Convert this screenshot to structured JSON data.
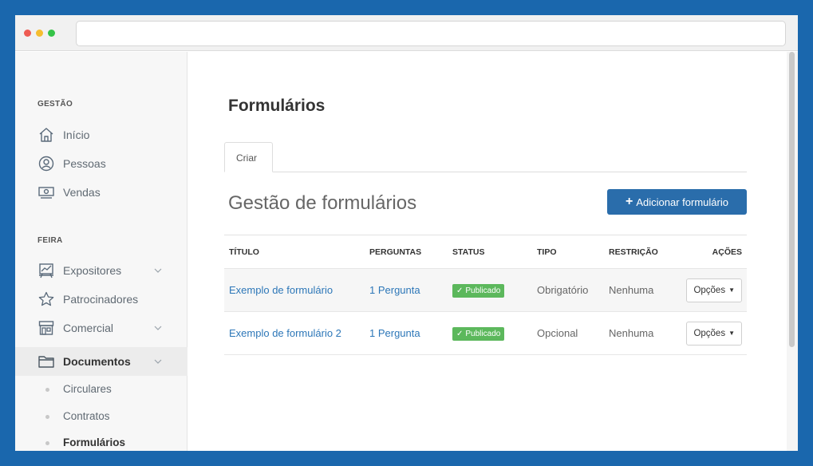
{
  "sidebar": {
    "sections": [
      {
        "label": "GESTÃO",
        "items": [
          {
            "label": "Início",
            "icon": "home-icon"
          },
          {
            "label": "Pessoas",
            "icon": "person-icon"
          },
          {
            "label": "Vendas",
            "icon": "money-icon"
          }
        ]
      },
      {
        "label": "FEIRA",
        "items": [
          {
            "label": "Expositores",
            "icon": "chart-board-icon",
            "expandable": true
          },
          {
            "label": "Patrocinadores",
            "icon": "star-icon"
          },
          {
            "label": "Comercial",
            "icon": "storefront-icon",
            "expandable": true
          },
          {
            "label": "Documentos",
            "icon": "folder-icon",
            "expandable": true,
            "active": true
          }
        ]
      }
    ],
    "subitems": [
      "Circulares",
      "Contratos",
      "Formulários"
    ]
  },
  "main": {
    "page_title": "Formulários",
    "tabs": [
      {
        "label": "Criar"
      }
    ],
    "section_title": "Gestão de formulários",
    "add_button": {
      "icon": "+",
      "label": "Adicionar formulário"
    },
    "table": {
      "columns": [
        "TÍTULO",
        "PERGUNTAS",
        "STATUS",
        "TIPO",
        "RESTRIÇÃO",
        "AÇÕES"
      ],
      "rows": [
        {
          "title": "Exemplo de formulário",
          "questions": "1 Pergunta",
          "status": "Publicado",
          "type": "Obrigatório",
          "restriction": "Nenhuma",
          "action": "Opções"
        },
        {
          "title": "Exemplo de formulário 2",
          "questions": "1 Pergunta",
          "status": "Publicado",
          "type": "Opcional",
          "restriction": "Nenhuma",
          "action": "Opções"
        }
      ]
    }
  },
  "colors": {
    "frame": "#1a67ad",
    "primary_button": "#2a6dab",
    "link": "#2d77b8",
    "badge_success": "#5cb85c"
  }
}
